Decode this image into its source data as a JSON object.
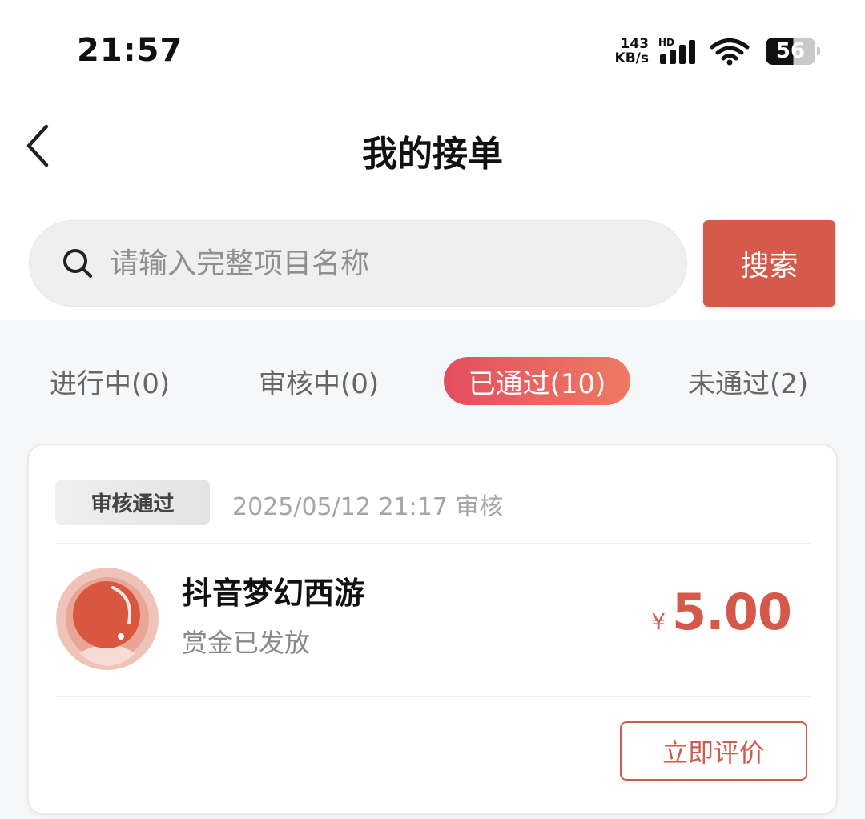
{
  "status_bar": {
    "time": "21:57",
    "net_speed_value": "143",
    "net_speed_unit": "KB/s",
    "signal_label": "HD",
    "battery": "56",
    "icons": [
      "signal-icon",
      "wifi-icon",
      "battery-icon"
    ]
  },
  "header": {
    "title": "我的接单",
    "back_icon": "chevron-left-icon"
  },
  "search": {
    "placeholder": "请输入完整项目名称",
    "value": "",
    "button_label": "搜索",
    "icon": "search-icon"
  },
  "tabs": [
    {
      "label": "进行中(0)",
      "active": false
    },
    {
      "label": "审核中(0)",
      "active": false
    },
    {
      "label": "已通过(10)",
      "active": true
    },
    {
      "label": "未通过(2)",
      "active": false
    }
  ],
  "orders": [
    {
      "status_badge": "审核通过",
      "review_time": "2025/05/12 21:17 审核",
      "project_name": "抖音梦幻西游",
      "project_status": "赏金已发放",
      "currency": "¥",
      "amount": "5.00",
      "action_label": "立即评价"
    }
  ],
  "colors": {
    "accent": "#d55a4c",
    "tab_gradient_start": "#e24f5f",
    "tab_gradient_end": "#ee7a63",
    "price": "#d4594b",
    "background": "#f6f7f9"
  }
}
